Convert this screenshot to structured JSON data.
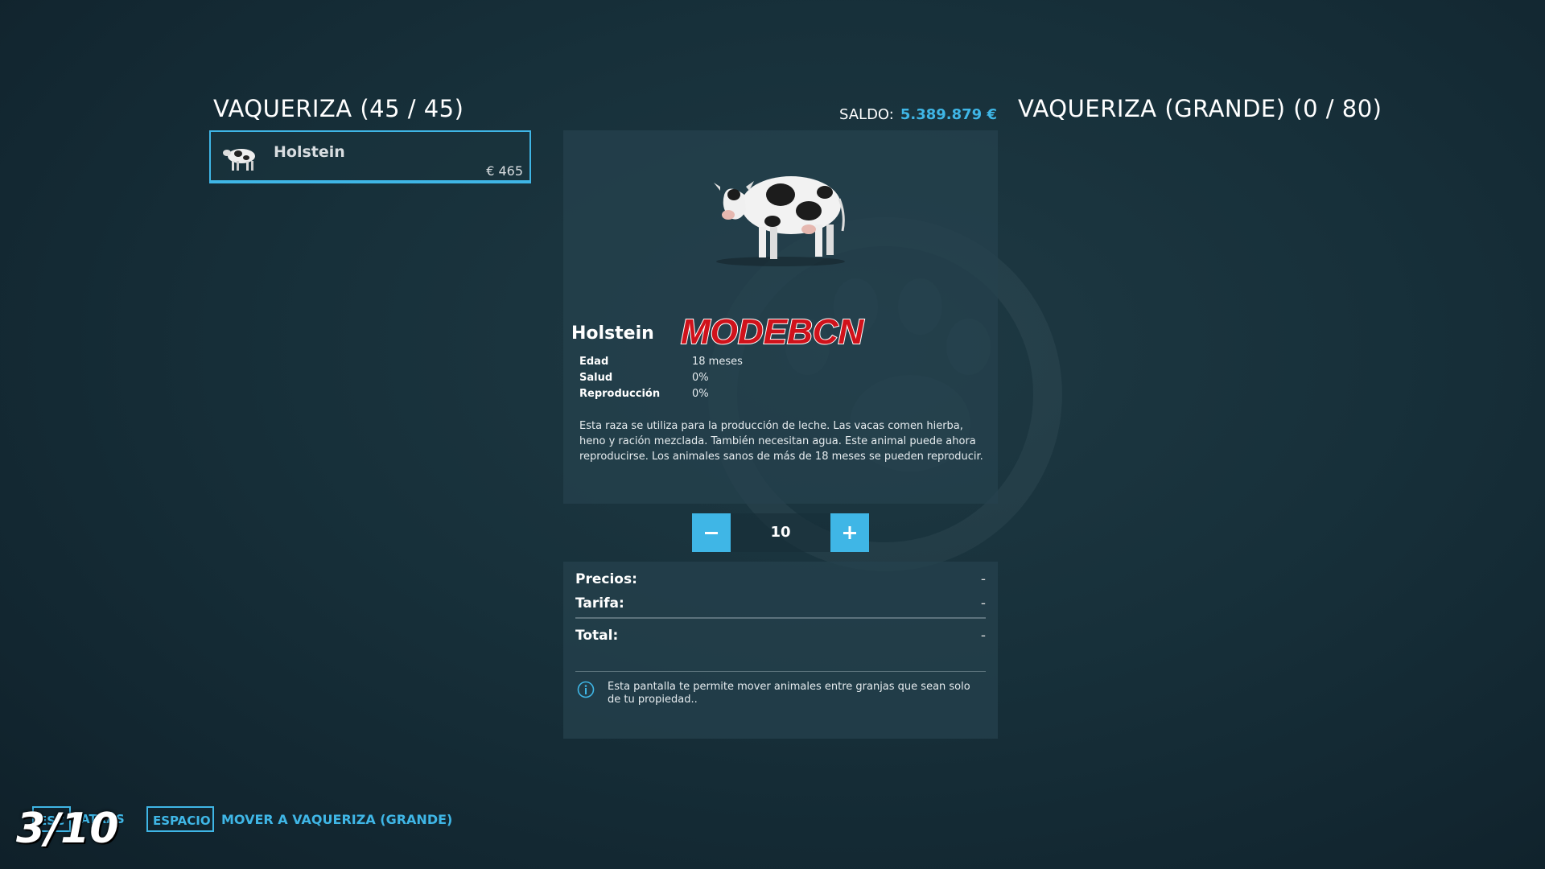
{
  "header": {
    "left_title": "VAQUERIZA (45 / 45)",
    "balance_label": "SALDO:",
    "balance_value": "5.389.879 €",
    "right_title": "VAQUERIZA (GRANDE) (0 / 80)"
  },
  "animal_list": [
    {
      "name": "Holstein",
      "price": "€ 465"
    }
  ],
  "detail": {
    "name": "Holstein",
    "watermark_logo": "MODEBCN",
    "stats": [
      {
        "label": "Edad",
        "value": "18  meses"
      },
      {
        "label": "Salud",
        "value": "0%"
      },
      {
        "label": "Reproducción",
        "value": "0%"
      }
    ],
    "description": "Esta raza se utiliza para la producción de leche. Las vacas comen hierba, heno y ración mezclada. También necesitan agua. Este animal puede ahora reproducirse. Los animales sanos de más de 18 meses se pueden reproducir."
  },
  "quantity": {
    "value": "10",
    "minus_icon": "minus-icon",
    "plus_icon": "plus-icon"
  },
  "prices": {
    "precios_label": "Precios:",
    "precios_value": "-",
    "tarifa_label": "Tarifa:",
    "tarifa_value": "-",
    "total_label": "Total:",
    "total_value": "-",
    "info_text": "Esta pantalla te permite mover animales entre granjas que sean solo de tu propiedad.."
  },
  "footer": {
    "back_key": "ESC",
    "back_label": "ATRÁS",
    "move_key": "ESPACIO",
    "move_label": "MOVER A VAQUERIZA (GRANDE)",
    "counter": "3/10"
  },
  "colors": {
    "accent": "#3fb6e6",
    "logo_red": "#d0121b"
  }
}
